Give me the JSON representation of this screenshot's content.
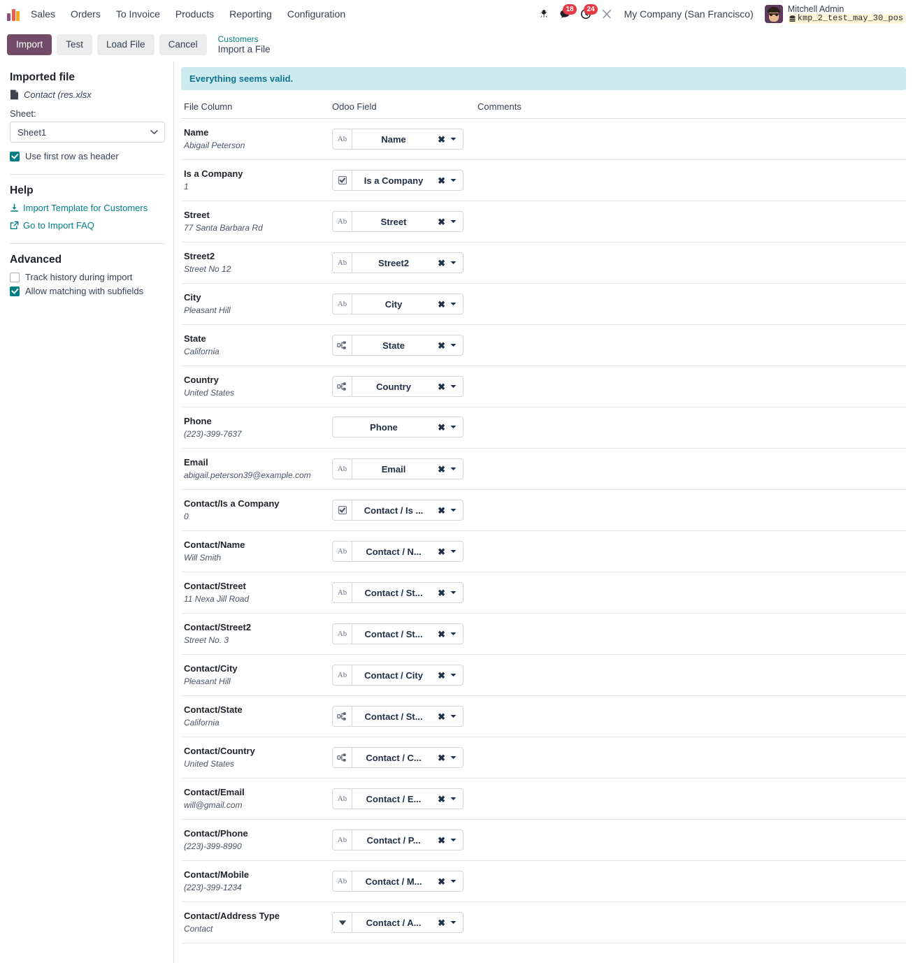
{
  "navbar": {
    "app_name": "Sales",
    "menu_items": [
      "Orders",
      "To Invoice",
      "Products",
      "Reporting",
      "Configuration"
    ],
    "icons": {
      "bug": "bug-icon",
      "messages": "chat-icon",
      "activities": "clock-icon",
      "tools": "wrench-icon"
    },
    "messages_count": "18",
    "activities_count": "24",
    "company": "My Company (San Francisco)",
    "user_name": "Mitchell Admin",
    "database": "kmp_2_test_may_30_pos"
  },
  "control_panel": {
    "import_label": "Import",
    "test_label": "Test",
    "load_file_label": "Load File",
    "cancel_label": "Cancel",
    "breadcrumb_parent": "Customers",
    "breadcrumb_current": "Import a File"
  },
  "sidebar": {
    "imported_file_title": "Imported file",
    "file_name": "Contact (res.xlsx",
    "sheet_label": "Sheet:",
    "sheet_value": "Sheet1",
    "sheet_options": [
      "Sheet1"
    ],
    "use_first_row_label": "Use first row as header",
    "use_first_row_checked": true,
    "help_title": "Help",
    "help_links": [
      {
        "label": "Import Template for Customers",
        "icon": "download-icon"
      },
      {
        "label": "Go to Import FAQ",
        "icon": "external-link-icon"
      }
    ],
    "advanced_title": "Advanced",
    "advanced_options": [
      {
        "label": "Track history during import",
        "checked": false
      },
      {
        "label": "Allow matching with subfields",
        "checked": true
      }
    ]
  },
  "main": {
    "alert_text": "Everything seems valid.",
    "columns": {
      "file_column": "File Column",
      "odoo_field": "Odoo Field",
      "comments": "Comments"
    },
    "rows": [
      {
        "file_column": "Name",
        "sample": "Abigail Peterson",
        "field_label": "Name",
        "field_type": "text",
        "comment": ""
      },
      {
        "file_column": "Is a Company",
        "sample": "1",
        "field_label": "Is a Company",
        "field_type": "boolean",
        "comment": ""
      },
      {
        "file_column": "Street",
        "sample": "77 Santa Barbara Rd",
        "field_label": "Street",
        "field_type": "text",
        "comment": ""
      },
      {
        "file_column": "Street2",
        "sample": "Street No 12",
        "field_label": "Street2",
        "field_type": "text",
        "comment": ""
      },
      {
        "file_column": "City",
        "sample": "Pleasant Hill",
        "field_label": "City",
        "field_type": "text",
        "comment": ""
      },
      {
        "file_column": "State",
        "sample": "California",
        "field_label": "State",
        "field_type": "relation",
        "comment": ""
      },
      {
        "file_column": "Country",
        "sample": "United States",
        "field_label": "Country",
        "field_type": "relation",
        "comment": ""
      },
      {
        "file_column": "Phone",
        "sample": "(223)-399-7637",
        "field_label": "Phone",
        "field_type": "none",
        "comment": ""
      },
      {
        "file_column": "Email",
        "sample": "abigail.peterson39@example.com",
        "field_label": "Email",
        "field_type": "text",
        "comment": ""
      },
      {
        "file_column": "Contact/Is a Company",
        "sample": "0",
        "field_label": "Contact / Is ...",
        "field_type": "boolean",
        "comment": ""
      },
      {
        "file_column": "Contact/Name",
        "sample": "Will Smith",
        "field_label": "Contact / N...",
        "field_type": "text",
        "comment": ""
      },
      {
        "file_column": "Contact/Street",
        "sample": "11 Nexa Jill Road",
        "field_label": "Contact / St...",
        "field_type": "text",
        "comment": ""
      },
      {
        "file_column": "Contact/Street2",
        "sample": "Street No. 3",
        "field_label": "Contact / St...",
        "field_type": "text",
        "comment": ""
      },
      {
        "file_column": "Contact/City",
        "sample": "Pleasant Hill",
        "field_label": "Contact / City",
        "field_type": "text",
        "comment": ""
      },
      {
        "file_column": "Contact/State",
        "sample": "California",
        "field_label": "Contact / St...",
        "field_type": "relation",
        "comment": ""
      },
      {
        "file_column": "Contact/Country",
        "sample": "United States",
        "field_label": "Contact / C...",
        "field_type": "relation",
        "comment": ""
      },
      {
        "file_column": "Contact/Email",
        "sample": "will@gmail.com",
        "field_label": "Contact / E...",
        "field_type": "text",
        "comment": ""
      },
      {
        "file_column": "Contact/Phone",
        "sample": "(223)-399-8990",
        "field_label": "Contact / P...",
        "field_type": "text",
        "comment": ""
      },
      {
        "file_column": "Contact/Mobile",
        "sample": "(223)-399-1234",
        "field_label": "Contact / M...",
        "field_type": "text",
        "comment": ""
      },
      {
        "file_column": "Contact/Address Type",
        "sample": "Contact",
        "field_label": "Contact / A...",
        "field_type": "selection",
        "comment": ""
      }
    ],
    "clear_icon": "close-icon",
    "dropdown_icon": "chevron-down-icon"
  },
  "colors": {
    "primary": "#714b67",
    "link": "#017e84",
    "alert_bg": "#cdeaef",
    "alert_text": "#0e7490",
    "badge": "#e63946"
  }
}
